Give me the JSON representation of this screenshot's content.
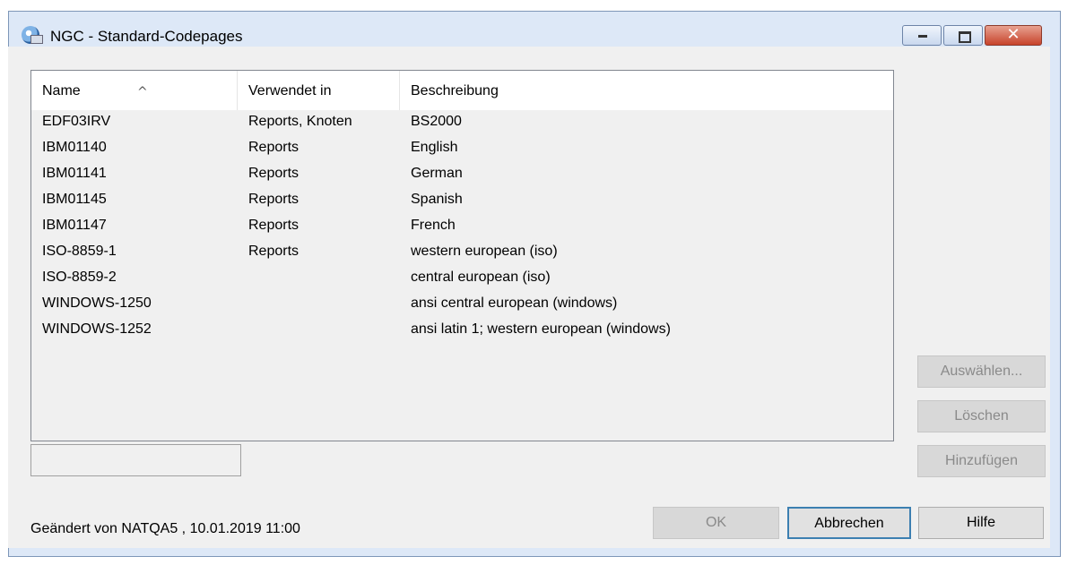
{
  "window": {
    "title": "NGC - Standard-Codepages",
    "controls": {
      "minimize_icon": "minimize-icon",
      "maximize_icon": "maximize-icon",
      "close_icon": "close-icon",
      "close_glyph": "✕"
    }
  },
  "list": {
    "sort_indicator": "^",
    "columns": [
      "Name",
      "Verwendet in",
      "Beschreibung"
    ],
    "rows": [
      {
        "name": "EDF03IRV",
        "used_in": "Reports, Knoten",
        "description": "BS2000"
      },
      {
        "name": "IBM01140",
        "used_in": "Reports",
        "description": "English"
      },
      {
        "name": "IBM01141",
        "used_in": "Reports",
        "description": "German"
      },
      {
        "name": "IBM01145",
        "used_in": "Reports",
        "description": "Spanish"
      },
      {
        "name": "IBM01147",
        "used_in": "Reports",
        "description": "French"
      },
      {
        "name": "ISO-8859-1",
        "used_in": "Reports",
        "description": "western european (iso)"
      },
      {
        "name": "ISO-8859-2",
        "used_in": "",
        "description": "central european (iso)"
      },
      {
        "name": "WINDOWS-1250",
        "used_in": "",
        "description": "ansi central european (windows)"
      },
      {
        "name": "WINDOWS-1252",
        "used_in": "",
        "description": "ansi latin 1; western european (windows)"
      }
    ]
  },
  "side_buttons": {
    "select_label": "Auswählen...",
    "delete_label": "Löschen",
    "add_label": "Hinzufügen"
  },
  "status": {
    "text": "Geändert von NATQA5 , 10.01.2019 11:00",
    "field_value": ""
  },
  "footer_buttons": {
    "ok_label": "OK",
    "cancel_label": "Abbrechen",
    "help_label": "Hilfe"
  },
  "colors": {
    "frame": "#dde8f7",
    "close_button": "#c7432b",
    "default_button_border": "#3c7fb1"
  }
}
